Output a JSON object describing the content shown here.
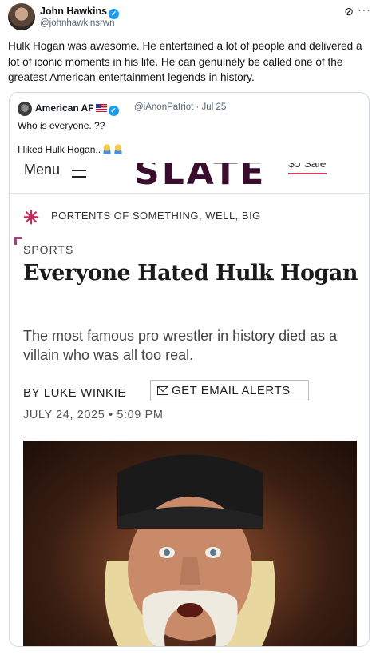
{
  "tweet": {
    "author_name": "John Hawkins",
    "author_handle": "@johnhawkinsrwn",
    "text": "Hulk Hogan was awesome. He entertained a lot of people and delivered a lot of iconic moments in his life. He can genuinely be called one of the greatest American entertainment legends in history."
  },
  "quoted": {
    "author_name": "American AF",
    "author_handle": "@iAnonPatriot · Jul 25",
    "line1": "Who is everyone..??",
    "line2": "I liked Hulk Hogan.."
  },
  "article": {
    "menu_label": "Menu",
    "logo": "SLATE",
    "sale_label": "$5 Sale",
    "series_label": "PORTENTS OF SOMETHING, WELL, BIG",
    "section": "SPORTS",
    "headline": "Everyone Hated Hulk Hogan",
    "dek": "The most famous pro wrestler in history died as a villain who was all too real.",
    "byline": "BY LUKE WINKIE",
    "email_button": "GET EMAIL ALERTS",
    "dateline": "JULY 24, 2025 • 5:09 PM"
  },
  "icons": [
    "verified-badge-icon",
    "grok-icon",
    "more-icon",
    "us-flag-icon",
    "shrug-emoji-icon",
    "hamburger-menu-icon",
    "portents-logo-icon",
    "mail-icon"
  ],
  "colors": {
    "verified": "#1d9bf0",
    "slate_logo": "#3a0d2e",
    "portents": "#c8255a",
    "sale_underline": "#d63a5a"
  }
}
